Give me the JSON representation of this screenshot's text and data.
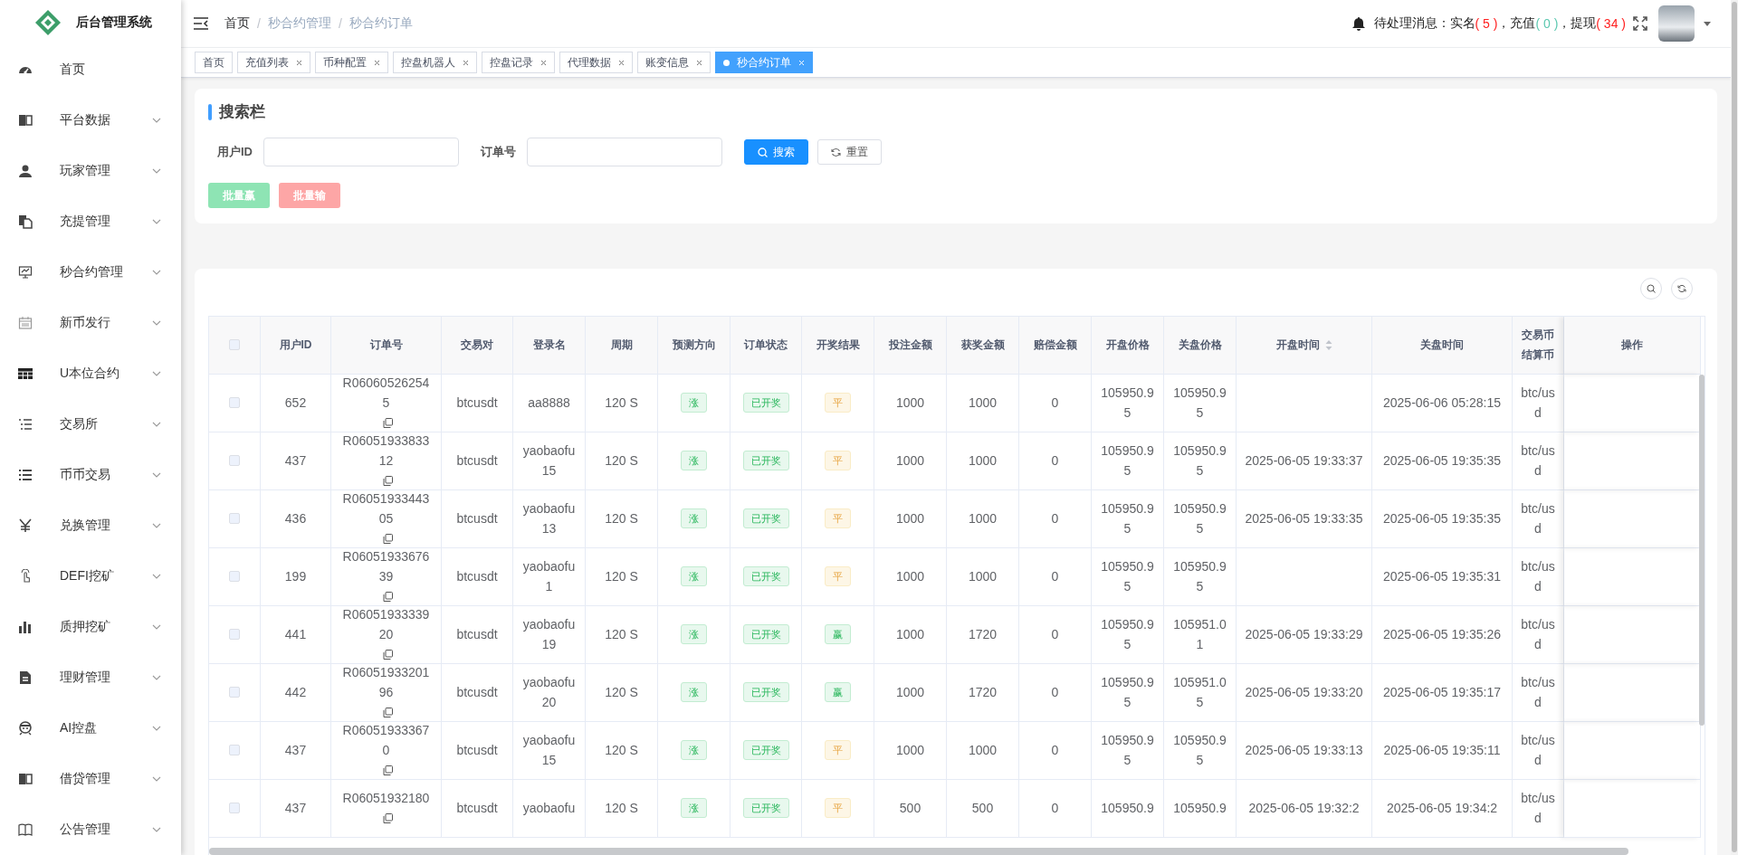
{
  "sidebar": {
    "logo_title": "后台管理系统",
    "items": [
      {
        "label": "首页",
        "expandable": false
      },
      {
        "label": "平台数据",
        "expandable": true
      },
      {
        "label": "玩家管理",
        "expandable": true
      },
      {
        "label": "充提管理",
        "expandable": true
      },
      {
        "label": "秒合约管理",
        "expandable": true
      },
      {
        "label": "新币发行",
        "expandable": true
      },
      {
        "label": "U本位合约",
        "expandable": true
      },
      {
        "label": "交易所",
        "expandable": true
      },
      {
        "label": "币币交易",
        "expandable": true
      },
      {
        "label": "兑换管理",
        "expandable": true
      },
      {
        "label": "DEFI挖矿",
        "expandable": true
      },
      {
        "label": "质押挖矿",
        "expandable": true
      },
      {
        "label": "理财管理",
        "expandable": true
      },
      {
        "label": "AI控盘",
        "expandable": true
      },
      {
        "label": "借贷管理",
        "expandable": true
      },
      {
        "label": "公告管理",
        "expandable": true
      }
    ]
  },
  "header": {
    "breadcrumb": [
      {
        "label": "首页",
        "current": false
      },
      {
        "label": "秒合约管理",
        "current": true
      },
      {
        "label": "秒合约订单",
        "current": true
      }
    ],
    "breadcrumb_separator": "/",
    "notice": {
      "label": "待处理消息：",
      "separator": "，",
      "items": [
        {
          "name": "实名",
          "count": "( 5 )",
          "color": "#ff2020"
        },
        {
          "name": "充值",
          "count": "( 0 )",
          "color": "#5cc8b0"
        },
        {
          "name": "提现",
          "count": "( 34 )",
          "color": "#ff2020"
        }
      ]
    }
  },
  "tabs": [
    {
      "label": "首页",
      "closable": false,
      "selected": false
    },
    {
      "label": "充值列表",
      "closable": true,
      "selected": false
    },
    {
      "label": "币种配置",
      "closable": true,
      "selected": false
    },
    {
      "label": "控盘机器人",
      "closable": true,
      "selected": false
    },
    {
      "label": "控盘记录",
      "closable": true,
      "selected": false
    },
    {
      "label": "代理数据",
      "closable": true,
      "selected": false
    },
    {
      "label": "账变信息",
      "closable": true,
      "selected": false
    },
    {
      "label": "秒合约订单",
      "closable": true,
      "selected": true
    }
  ],
  "search": {
    "title": "搜索栏",
    "fields": [
      {
        "label": "用户ID"
      },
      {
        "label": "订单号"
      }
    ],
    "search_button": "搜索",
    "reset_button": "重置",
    "batch_buttons": [
      {
        "label": "批量赢",
        "kind": "win"
      },
      {
        "label": "批量输",
        "kind": "lose"
      }
    ]
  },
  "table": {
    "columns": [
      {
        "label": "用户ID",
        "sortable": false
      },
      {
        "label": "订单号",
        "sortable": false
      },
      {
        "label": "交易对",
        "sortable": false
      },
      {
        "label": "登录名",
        "sortable": false
      },
      {
        "label": "周期",
        "sortable": false
      },
      {
        "label": "预测方向",
        "sortable": false
      },
      {
        "label": "订单状态",
        "sortable": false
      },
      {
        "label": "开奖结果",
        "sortable": false
      },
      {
        "label": "投注金额",
        "sortable": false
      },
      {
        "label": "获奖金额",
        "sortable": false
      },
      {
        "label": "赔偿金额",
        "sortable": false
      },
      {
        "label": "开盘价格",
        "sortable": false
      },
      {
        "label": "关盘价格",
        "sortable": false
      },
      {
        "label": "开盘时间",
        "sortable": true
      },
      {
        "label": "关盘时间",
        "sortable": false
      },
      {
        "lines": [
          "交易币",
          "结算币"
        ],
        "sortable": false
      },
      {
        "label": "操作",
        "sortable": false
      }
    ],
    "select_all_checked": false,
    "rows": [
      {
        "checked": false,
        "user_id": "652",
        "order_no": "R060605262545",
        "pair": "btcusdt",
        "login": "aa8888",
        "period": "120 S",
        "direction": {
          "text": "涨",
          "kind": "up"
        },
        "status": {
          "text": "已开奖",
          "kind": "settled"
        },
        "result": {
          "text": "平",
          "kind": "draw"
        },
        "bet": "1000",
        "prize": "1000",
        "compensation": "0",
        "open_price": "105950.95",
        "close_price": "105950.95",
        "close_time": "2025-06-06 05:28:15",
        "currency": "btc/usd"
      },
      {
        "checked": false,
        "user_id": "437",
        "order_no": "R0605193383312",
        "pair": "btcusdt",
        "login": "yaobaofu15",
        "period": "120 S",
        "direction": {
          "text": "涨",
          "kind": "up"
        },
        "status": {
          "text": "已开奖",
          "kind": "settled"
        },
        "result": {
          "text": "平",
          "kind": "draw"
        },
        "bet": "1000",
        "prize": "1000",
        "compensation": "0",
        "open_price": "105950.95",
        "close_price": "105950.95",
        "open_time": "2025-06-05 19:33:37",
        "close_time": "2025-06-05 19:35:35",
        "currency": "btc/usd"
      },
      {
        "checked": false,
        "user_id": "436",
        "order_no": "R0605193344305",
        "pair": "btcusdt",
        "login": "yaobaofu13",
        "period": "120 S",
        "direction": {
          "text": "涨",
          "kind": "up"
        },
        "status": {
          "text": "已开奖",
          "kind": "settled"
        },
        "result": {
          "text": "平",
          "kind": "draw"
        },
        "bet": "1000",
        "prize": "1000",
        "compensation": "0",
        "open_price": "105950.95",
        "close_price": "105950.95",
        "open_time": "2025-06-05 19:33:35",
        "close_time": "2025-06-05 19:35:35",
        "currency": "btc/usd"
      },
      {
        "checked": false,
        "user_id": "199",
        "order_no": "R0605193367639",
        "pair": "btcusdt",
        "login": "yaobaofu1",
        "period": "120 S",
        "direction": {
          "text": "涨",
          "kind": "up"
        },
        "status": {
          "text": "已开奖",
          "kind": "settled"
        },
        "result": {
          "text": "平",
          "kind": "draw"
        },
        "bet": "1000",
        "prize": "1000",
        "compensation": "0",
        "open_price": "105950.95",
        "close_price": "105950.95",
        "close_time": "2025-06-05 19:35:31",
        "currency": "btc/usd"
      },
      {
        "checked": false,
        "user_id": "441",
        "order_no": "R0605193333920",
        "pair": "btcusdt",
        "login": "yaobaofu19",
        "period": "120 S",
        "direction": {
          "text": "涨",
          "kind": "up"
        },
        "status": {
          "text": "已开奖",
          "kind": "settled"
        },
        "result": {
          "text": "赢",
          "kind": "win"
        },
        "bet": "1000",
        "prize": "1720",
        "compensation": "0",
        "open_price": "105950.95",
        "close_price": "105951.01",
        "open_time": "2025-06-05 19:33:29",
        "close_time": "2025-06-05 19:35:26",
        "currency": "btc/usd"
      },
      {
        "checked": false,
        "user_id": "442",
        "order_no": "R0605193320196",
        "pair": "btcusdt",
        "login": "yaobaofu20",
        "period": "120 S",
        "direction": {
          "text": "涨",
          "kind": "up"
        },
        "status": {
          "text": "已开奖",
          "kind": "settled"
        },
        "result": {
          "text": "赢",
          "kind": "win"
        },
        "bet": "1000",
        "prize": "1720",
        "compensation": "0",
        "open_price": "105950.95",
        "close_price": "105951.05",
        "open_time": "2025-06-05 19:33:20",
        "close_time": "2025-06-05 19:35:17",
        "currency": "btc/usd"
      },
      {
        "checked": false,
        "user_id": "437",
        "order_no": "R060519333670",
        "pair": "btcusdt",
        "login": "yaobaofu15",
        "period": "120 S",
        "direction": {
          "text": "涨",
          "kind": "up"
        },
        "status": {
          "text": "已开奖",
          "kind": "settled"
        },
        "result": {
          "text": "平",
          "kind": "draw"
        },
        "bet": "1000",
        "prize": "1000",
        "compensation": "0",
        "open_price": "105950.95",
        "close_price": "105950.95",
        "open_time": "2025-06-05 19:33:13",
        "close_time": "2025-06-05 19:35:11",
        "currency": "btc/usd"
      },
      {
        "checked": false,
        "user_id": "437",
        "order_no": "R06051932180",
        "pair": "btcusdt",
        "login": "yaobaofu",
        "period": "120 S",
        "direction": {
          "text": "涨",
          "kind": "up"
        },
        "status": {
          "text": "已开奖",
          "kind": "settled"
        },
        "result": {
          "text": "平",
          "kind": "draw"
        },
        "bet": "500",
        "prize": "500",
        "compensation": "0",
        "open_price": "105950.9",
        "close_price": "105950.9",
        "open_time": "2025-06-05 19:32:2",
        "close_time": "2025-06-05 19:34:2",
        "currency": "btc/usd"
      }
    ]
  }
}
